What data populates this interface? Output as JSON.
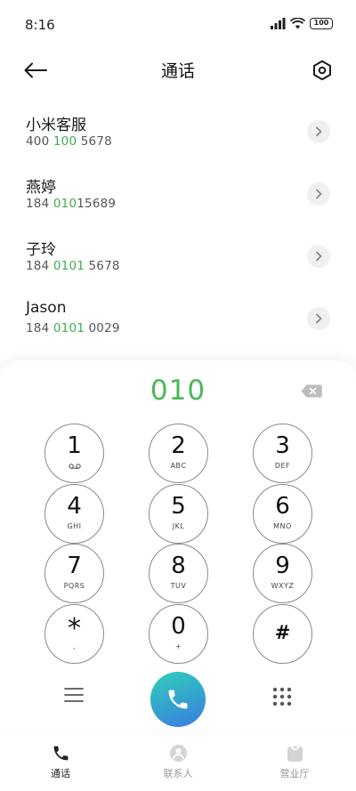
{
  "status": {
    "time": "8:16",
    "battery": "100"
  },
  "header": {
    "title": "通话"
  },
  "contacts": [
    {
      "name": "小米客服",
      "num_parts": [
        "400",
        " 100",
        " 5678"
      ]
    },
    {
      "name": "燕婷",
      "num_parts": [
        "184 ",
        "010",
        "15689"
      ]
    },
    {
      "name": "子玲",
      "num_parts": [
        "184 ",
        "0101",
        " 5678"
      ]
    },
    {
      "name": "Jason",
      "num_parts": [
        "184 ",
        "0101",
        " 0029"
      ]
    }
  ],
  "dialer": {
    "input": "010",
    "keys": [
      {
        "digit": "1",
        "letters": ""
      },
      {
        "digit": "2",
        "letters": "ABC"
      },
      {
        "digit": "3",
        "letters": "DEF"
      },
      {
        "digit": "4",
        "letters": "GHI"
      },
      {
        "digit": "5",
        "letters": "JKL"
      },
      {
        "digit": "6",
        "letters": "MNO"
      },
      {
        "digit": "7",
        "letters": "PQRS"
      },
      {
        "digit": "8",
        "letters": "TUV"
      },
      {
        "digit": "9",
        "letters": "WXYZ"
      },
      {
        "digit": "*",
        "letters": ","
      },
      {
        "digit": "0",
        "letters": "+"
      },
      {
        "digit": "#",
        "letters": ""
      }
    ]
  },
  "tabs": [
    {
      "label": "通话",
      "icon": "phone-icon",
      "active": true
    },
    {
      "label": "联系人",
      "icon": "person-icon",
      "active": false
    },
    {
      "label": "营业厅",
      "icon": "shopping-bag-icon",
      "active": false
    }
  ],
  "colors": {
    "highlight": "#3fae4a",
    "call_gradient_start": "#2fd0b9",
    "call_gradient_end": "#3a7be0"
  }
}
